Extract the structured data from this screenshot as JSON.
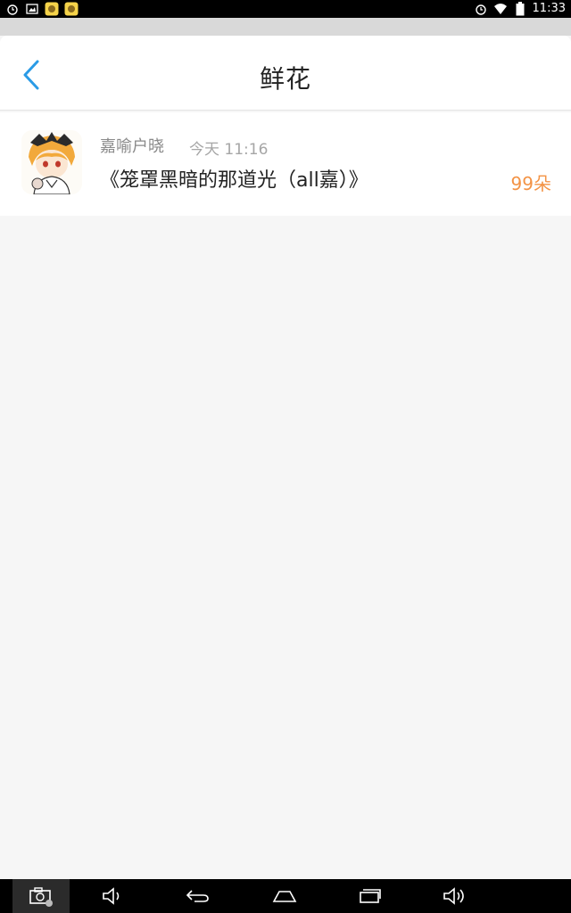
{
  "status_bar": {
    "time": "11:33",
    "left_icons": [
      "alarm-icon",
      "image-icon",
      "app-icon",
      "app-icon"
    ],
    "right_icons": [
      "alarm-icon",
      "wifi-icon",
      "battery-icon"
    ]
  },
  "header": {
    "title": "鲜花",
    "back_icon": "chevron-left-icon",
    "accent_color": "#2a9be6"
  },
  "items": [
    {
      "author": "嘉喻户晓",
      "time": "今天 11:16",
      "title": "《笼罩黑暗的那道光（all嘉）》",
      "count": "99朵"
    }
  ],
  "colors": {
    "count": "#f39345",
    "background": "#f6f6f6"
  },
  "nav_bar": {
    "icons": [
      "screenshot-icon",
      "volume-down-icon",
      "back-icon",
      "home-icon",
      "recent-apps-icon",
      "volume-up-icon"
    ]
  }
}
